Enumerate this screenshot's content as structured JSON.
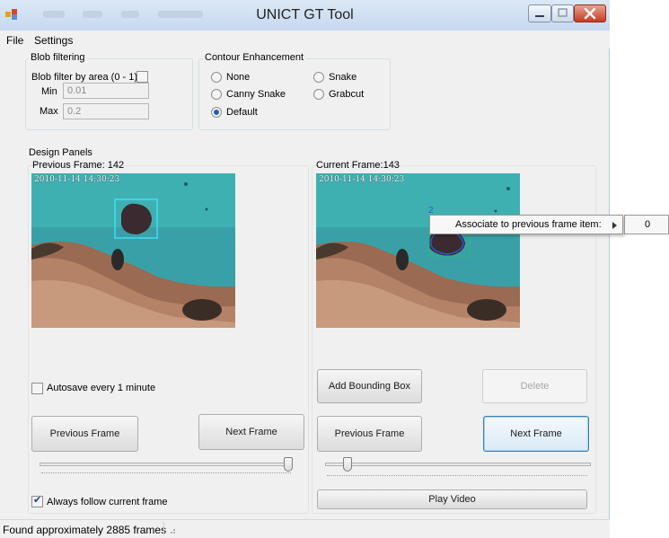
{
  "window": {
    "title": "UNICT GT Tool"
  },
  "menubar": {
    "file": "File",
    "settings": "Settings"
  },
  "blob_filtering": {
    "title": "Blob filtering",
    "filter_label": "Blob filter by area (0 - 1):",
    "filter_checked": false,
    "min_label": "Min",
    "min_value": "0.01",
    "max_label": "Max",
    "max_value": "0.2"
  },
  "contour": {
    "title": "Contour Enhancement",
    "options": [
      "None",
      "Snake",
      "Canny Snake",
      "Grabcut",
      "Default"
    ],
    "selected": "Default"
  },
  "design_panels": {
    "title": "Design Panels",
    "left": {
      "frame_label": "Previous Frame: 142",
      "timestamp": "2010-11-14 14:30:23",
      "autosave_label": "Autosave every 1 minute",
      "autosave_checked": false,
      "prev_button": "Previous Frame",
      "next_button": "Next Frame",
      "slider_level": 1.0,
      "follow_label": "Always follow current frame",
      "follow_checked": true
    },
    "right": {
      "frame_label": "Current Frame:143",
      "timestamp": "2010-11-14 14:30:23",
      "object_marker": "2",
      "add_bbox_button": "Add Bounding Box",
      "delete_button": "Delete",
      "prev_button": "Previous Frame",
      "next_button": "Next Frame",
      "slider_level": 0.07,
      "play_button": "Play Video"
    }
  },
  "context_menu": {
    "item": "Associate to previous frame item:",
    "submenu_value": "0"
  },
  "status": {
    "text": "Found approximately 2885 frames"
  },
  "colors": {
    "title_bg": "#c7d9ee",
    "accent": "#3c7fb1",
    "close": "#c43b22",
    "window_bg": "#f0f0f0"
  }
}
